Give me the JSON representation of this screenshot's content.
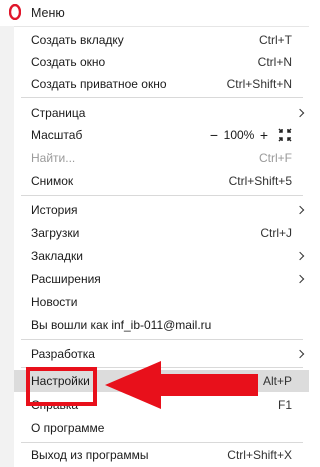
{
  "header": {
    "title": "Меню",
    "logo": "opera-logo-icon"
  },
  "items": {
    "new_tab": {
      "label": "Создать вкладку",
      "shortcut": "Ctrl+T"
    },
    "new_window": {
      "label": "Создать окно",
      "shortcut": "Ctrl+N"
    },
    "new_private": {
      "label": "Создать приватное окно",
      "shortcut": "Ctrl+Shift+N"
    },
    "page": {
      "label": "Страница"
    },
    "zoom": {
      "label": "Масштаб",
      "minus": "−",
      "value": "100%",
      "plus": "+",
      "fullscreen_icon": "fullscreen-icon"
    },
    "find": {
      "label": "Найти...",
      "shortcut": "Ctrl+F"
    },
    "snapshot": {
      "label": "Снимок",
      "shortcut": "Ctrl+Shift+5"
    },
    "history": {
      "label": "История"
    },
    "downloads": {
      "label": "Загрузки",
      "shortcut": "Ctrl+J"
    },
    "bookmarks": {
      "label": "Закладки"
    },
    "extensions": {
      "label": "Расширения"
    },
    "news": {
      "label": "Новости"
    },
    "signed_in": {
      "label": "Вы вошли как inf_ib-011@mail.ru"
    },
    "developer": {
      "label": "Разработка"
    },
    "settings": {
      "label": "Настройки",
      "shortcut": "Alt+P"
    },
    "help": {
      "label": "Справка",
      "shortcut": "F1"
    },
    "about": {
      "label": "О программе"
    },
    "exit": {
      "label": "Выход из программы",
      "shortcut": "Ctrl+Shift+X"
    }
  },
  "colors": {
    "highlight": "#dcdcdc",
    "annotation_red": "#e8101b",
    "opera_red": "#e0162b"
  }
}
